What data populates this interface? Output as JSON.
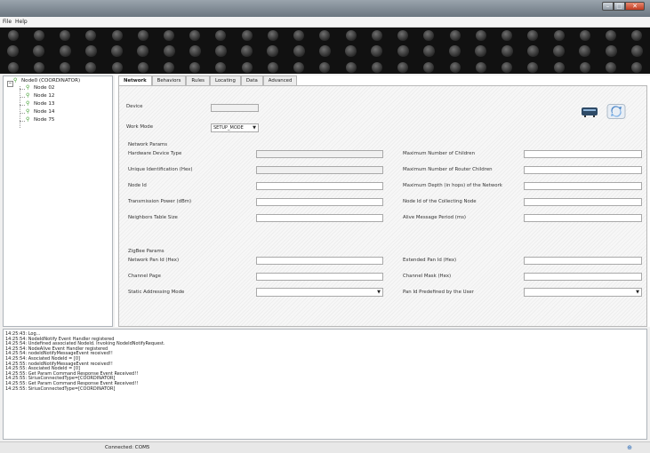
{
  "menu": {
    "file": "File",
    "help": "Help"
  },
  "window_controls": {
    "minimize": "–",
    "maximize": "□",
    "close": "✕"
  },
  "tree": {
    "root": "Node0 (COORDINATOR)",
    "children": [
      "Node 02",
      "Node 12",
      "Node 13",
      "Node 14",
      "Node 75"
    ]
  },
  "tabs": [
    "Network",
    "Behaviors",
    "Rules",
    "Locating",
    "Data",
    "Advanced"
  ],
  "form": {
    "device_label": "Device",
    "work_mode_label": "Work Mode",
    "work_mode_value": "SETUP_MODE",
    "network_params_title": "Network Params",
    "network_left": [
      "Hardware Device Type",
      "Unique Identification (Hex)",
      "Node Id",
      "Transmission Power (dBm)",
      "Neighbors Table Size"
    ],
    "network_right": [
      "Maximum Number of Children",
      "Maximum Number of Router Children",
      "Maximum Depth (in hops) of the Network",
      "Node Id of the Collecting Node",
      "Alive Message Period (ms)"
    ],
    "zigbee_title": "ZigBee Params",
    "zigbee_left": [
      "Network Pan Id (Hex)",
      "Channel Page",
      "Static Addressing Mode"
    ],
    "zigbee_right": [
      "Extended Pan Id (Hex)",
      "Channel Mask (Hex)",
      "Pan Id Predefined by the User"
    ]
  },
  "log_lines": [
    "14:25:43: Log...",
    "14:25:54: NodeIdNotify Event Handler registered",
    "14:25:54: Undefined associated NodeId. Invoking NodeIdNotifyRequest.",
    "14:25:54: NodeAlive Event Handler registered",
    "14:25:54: nodeIdNotifyMessageEvent received!!",
    "14:25:54: Asociated NodeId = [0]",
    "14:25:55: nodeIdNotifyMessageEvent received!!",
    "14:25:55: Asociated NodeId = [0]",
    "14:25:55: Get Param Command Response Event Received!!",
    "14:25:55: SiriusConnectedType=[COORDINATOR]",
    "14:25:55: Get Param Command Response Event Received!!",
    "14:25:55: SiriusConnectedType=[COORDINATOR]"
  ],
  "status": {
    "connection": "Connected: COM5"
  },
  "icons": {
    "toolbar_left": "module-icon",
    "toolbar_right": "refresh-icon",
    "status": "network-icon"
  }
}
